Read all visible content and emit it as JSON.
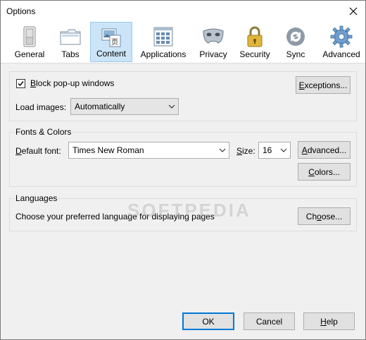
{
  "window": {
    "title": "Options"
  },
  "toolbar": {
    "tabs": [
      {
        "label": "General",
        "icon": "switch-icon"
      },
      {
        "label": "Tabs",
        "icon": "tabs-icon"
      },
      {
        "label": "Content",
        "icon": "content-icon",
        "selected": true
      },
      {
        "label": "Applications",
        "icon": "applications-icon"
      },
      {
        "label": "Privacy",
        "icon": "mask-icon"
      },
      {
        "label": "Security",
        "icon": "padlock-icon"
      },
      {
        "label": "Sync",
        "icon": "sync-icon"
      },
      {
        "label": "Advanced",
        "icon": "gear-icon"
      }
    ]
  },
  "popups": {
    "block_label_pre": "",
    "block_label_u": "B",
    "block_label_post": "lock pop-up windows",
    "block_checked": true,
    "exceptions_u": "E",
    "exceptions_rest": "xceptions...",
    "load_images_label": "Load images:",
    "load_images_value": "Automatically"
  },
  "fonts": {
    "group_title": "Fonts & Colors",
    "default_font_pre": "",
    "default_font_u": "D",
    "default_font_post": "efault font:",
    "default_font_value": "Times New Roman",
    "size_pre": "",
    "size_u": "S",
    "size_post": "ize:",
    "size_value": "16",
    "advanced_u": "A",
    "advanced_rest": "dvanced...",
    "colors_u": "C",
    "colors_rest": "olors..."
  },
  "languages": {
    "group_title": "Languages",
    "description": "Choose your preferred language for displaying pages",
    "choose_pre": "Ch",
    "choose_u": "o",
    "choose_post": "ose..."
  },
  "footer": {
    "ok": "OK",
    "cancel": "Cancel",
    "help_u": "H",
    "help_rest": "elp"
  },
  "watermark": "SOFTPEDIA",
  "colors": {
    "accent": "#0078d7",
    "selected_tab_bg": "#cce4f7"
  }
}
